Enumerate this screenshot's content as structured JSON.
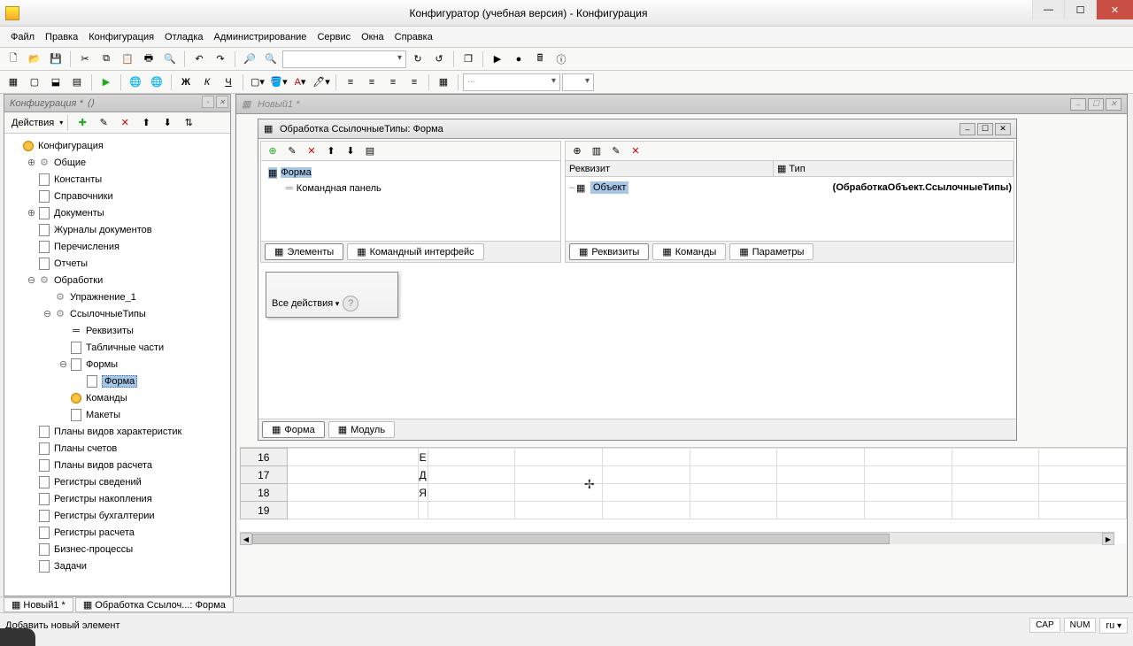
{
  "app": {
    "title": "Конфигуратор (учебная версия) - Конфигурация"
  },
  "menu": [
    "Файл",
    "Правка",
    "Конфигурация",
    "Отладка",
    "Администрирование",
    "Сервис",
    "Окна",
    "Справка"
  ],
  "sidebar": {
    "title": "Конфигурация *",
    "actions_label": "Действия",
    "tree": [
      {
        "lvl": 0,
        "tw": "",
        "ic": "cube",
        "label": "Конфигурация"
      },
      {
        "lvl": 1,
        "tw": "⊕",
        "ic": "gear",
        "label": "Общие"
      },
      {
        "lvl": 1,
        "tw": "",
        "ic": "doc",
        "label": "Константы"
      },
      {
        "lvl": 1,
        "tw": "",
        "ic": "doc",
        "label": "Справочники"
      },
      {
        "lvl": 1,
        "tw": "⊕",
        "ic": "doc",
        "label": "Документы"
      },
      {
        "lvl": 1,
        "tw": "",
        "ic": "doc",
        "label": "Журналы документов"
      },
      {
        "lvl": 1,
        "tw": "",
        "ic": "doc",
        "label": "Перечисления"
      },
      {
        "lvl": 1,
        "tw": "",
        "ic": "doc",
        "label": "Отчеты"
      },
      {
        "lvl": 1,
        "tw": "⊖",
        "ic": "gear",
        "label": "Обработки"
      },
      {
        "lvl": 2,
        "tw": "",
        "ic": "gear",
        "label": "Упражнение_1"
      },
      {
        "lvl": 2,
        "tw": "⊖",
        "ic": "gear",
        "label": "СсылочныеТипы"
      },
      {
        "lvl": 3,
        "tw": "",
        "ic": "dash",
        "label": "Реквизиты"
      },
      {
        "lvl": 3,
        "tw": "",
        "ic": "doc",
        "label": "Табличные части"
      },
      {
        "lvl": 3,
        "tw": "⊖",
        "ic": "doc",
        "label": "Формы"
      },
      {
        "lvl": 4,
        "tw": "",
        "ic": "doc",
        "label": "Форма",
        "sel": true
      },
      {
        "lvl": 3,
        "tw": "",
        "ic": "cube",
        "label": "Команды"
      },
      {
        "lvl": 3,
        "tw": "",
        "ic": "doc",
        "label": "Макеты"
      },
      {
        "lvl": 1,
        "tw": "",
        "ic": "doc",
        "label": "Планы видов характеристик"
      },
      {
        "lvl": 1,
        "tw": "",
        "ic": "doc",
        "label": "Планы счетов"
      },
      {
        "lvl": 1,
        "tw": "",
        "ic": "doc",
        "label": "Планы видов расчета"
      },
      {
        "lvl": 1,
        "tw": "",
        "ic": "doc",
        "label": "Регистры сведений"
      },
      {
        "lvl": 1,
        "tw": "",
        "ic": "doc",
        "label": "Регистры накопления"
      },
      {
        "lvl": 1,
        "tw": "",
        "ic": "doc",
        "label": "Регистры бухгалтерии"
      },
      {
        "lvl": 1,
        "tw": "",
        "ic": "doc",
        "label": "Регистры расчета"
      },
      {
        "lvl": 1,
        "tw": "",
        "ic": "doc",
        "label": "Бизнес-процессы"
      },
      {
        "lvl": 1,
        "tw": "",
        "ic": "doc",
        "label": "Задачи"
      }
    ]
  },
  "mdi": {
    "bg_window_title": "Новый1 *",
    "form_window_title": "Обработка СсылочныеТипы: Форма",
    "left_tree": {
      "root": "Форма",
      "child": "Командная панель"
    },
    "left_tabs": [
      "Элементы",
      "Командный интерфейс"
    ],
    "right_cols": {
      "c1": "Реквизит",
      "c2": "Тип"
    },
    "right_row": {
      "name": "Объект",
      "type": "(ОбработкаОбъект.СсылочныеТипы)"
    },
    "right_tabs": [
      "Реквизиты",
      "Команды",
      "Параметры"
    ],
    "preview_actions": "Все действия",
    "bottom_tabs": [
      "Форма",
      "Модуль"
    ]
  },
  "sheet_rows": [
    {
      "n": "16",
      "v": "Е"
    },
    {
      "n": "17",
      "v": "Д"
    },
    {
      "n": "18",
      "v": "Я",
      "dashed": true
    },
    {
      "n": "19",
      "v": ""
    }
  ],
  "taskbar": [
    "Новый1 *",
    "Обработка Ссылоч...: Форма"
  ],
  "status": {
    "msg": "Добавить новый элемент",
    "cap": "CAP",
    "num": "NUM",
    "lang": "ru"
  }
}
